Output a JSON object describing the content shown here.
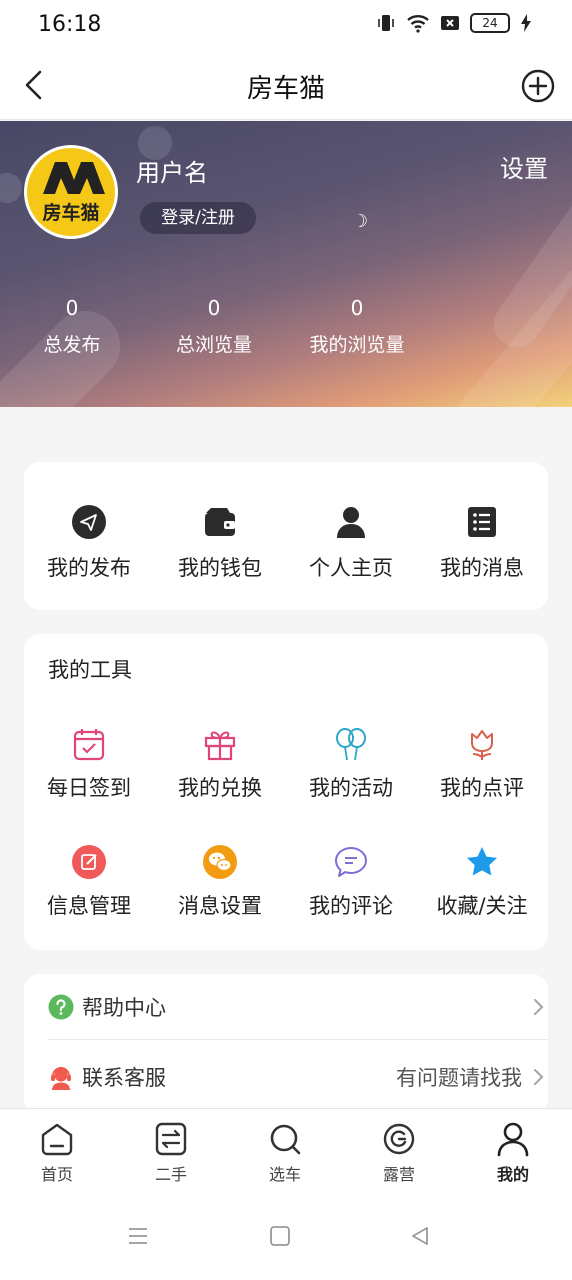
{
  "status_bar": {
    "time": "16:18",
    "battery": "24"
  },
  "nav": {
    "title": "房车猫"
  },
  "profile": {
    "username": "用户名",
    "login_label": "登录/注册",
    "settings_label": "设置",
    "avatar_text": "房车猫",
    "moon": "☽",
    "stats": [
      {
        "value": "0",
        "label": "总发布"
      },
      {
        "value": "0",
        "label": "总浏览量"
      },
      {
        "value": "0",
        "label": "我的浏览量"
      }
    ]
  },
  "quick_actions": [
    {
      "label": "我的发布",
      "icon": "send-icon"
    },
    {
      "label": "我的钱包",
      "icon": "wallet-icon"
    },
    {
      "label": "个人主页",
      "icon": "person-icon"
    },
    {
      "label": "我的消息",
      "icon": "message-list-icon"
    }
  ],
  "tools": {
    "heading": "我的工具",
    "items": [
      {
        "label": "每日签到",
        "icon": "calendar-check-icon",
        "color": "#e0457b"
      },
      {
        "label": "我的兑换",
        "icon": "gift-icon",
        "color": "#e0457b"
      },
      {
        "label": "我的活动",
        "icon": "balloon-icon",
        "color": "#2aa7c9"
      },
      {
        "label": "我的点评",
        "icon": "tulip-icon",
        "color": "#d9604a"
      },
      {
        "label": "信息管理",
        "icon": "edit-icon",
        "color": "#f05a5a"
      },
      {
        "label": "消息设置",
        "icon": "wechat-icon",
        "color": "#f39c12"
      },
      {
        "label": "我的评论",
        "icon": "comment-icon",
        "color": "#7b6fd6"
      },
      {
        "label": "收藏/关注",
        "icon": "star-icon",
        "color": "#1e9be8"
      }
    ]
  },
  "help": {
    "items": [
      {
        "label": "帮助中心",
        "right": "",
        "icon": "question-icon",
        "color": "#5cb85c"
      },
      {
        "label": "联系客服",
        "right": "有问题请找我",
        "icon": "support-agent-icon",
        "color": "#f05a4f"
      }
    ]
  },
  "tabbar": {
    "items": [
      {
        "label": "首页",
        "icon": "home-icon"
      },
      {
        "label": "二手",
        "icon": "swap-icon"
      },
      {
        "label": "选车",
        "icon": "search-icon"
      },
      {
        "label": "露营",
        "icon": "camp-icon"
      },
      {
        "label": "我的",
        "icon": "user-icon",
        "active": true
      }
    ]
  }
}
